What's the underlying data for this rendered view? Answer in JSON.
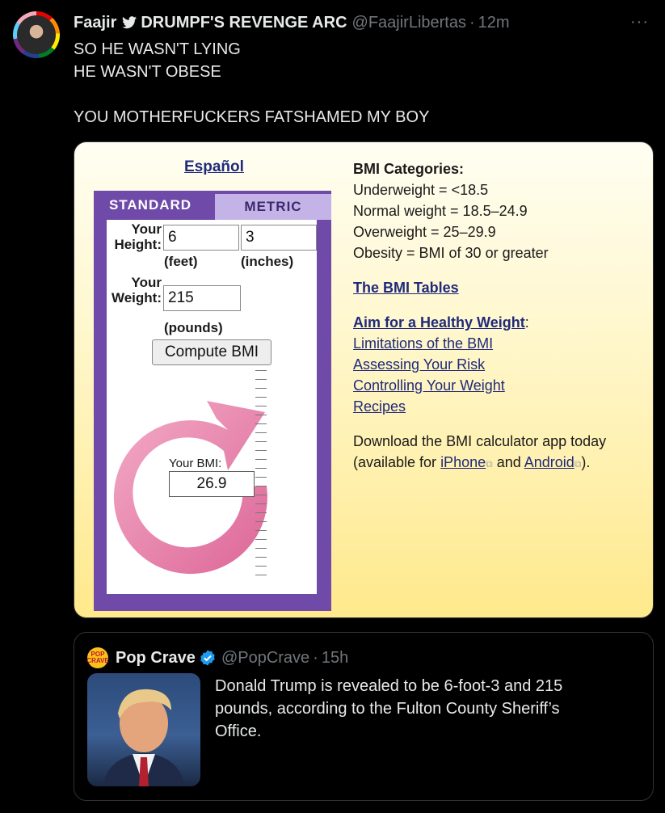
{
  "tweet": {
    "display_name": "Faajir",
    "name_suffix": "DRUMPF'S REVENGE ARC",
    "handle": "@FaajirLibertas",
    "separator": "·",
    "time": "12m",
    "more": "···",
    "lines": [
      "SO HE WASN'T LYING",
      "HE WASN'T OBESE",
      "",
      "YOU MOTHERFUCKERS FATSHAMED MY BOY"
    ]
  },
  "calculator": {
    "espanol": "Español",
    "tab_standard": "STANDARD",
    "tab_metric": "METRIC",
    "height_label_1": "Your",
    "height_label_2": "Height:",
    "feet_value": "6",
    "inches_value": "3",
    "feet_unit": "(feet)",
    "inches_unit": "(inches)",
    "weight_label_1": "Your",
    "weight_label_2": "Weight:",
    "weight_value": "215",
    "pounds_unit": "(pounds)",
    "compute_button": "Compute BMI",
    "your_bmi_label": "Your BMI:",
    "bmi_value": "26.9"
  },
  "bmi_info": {
    "categories_heading": "BMI Categories:",
    "categories": [
      "Underweight = <18.5",
      "Normal weight = 18.5–24.9",
      "Overweight = 25–29.9",
      "Obesity = BMI of 30 or greater"
    ],
    "bmi_tables_link": "The BMI Tables",
    "healthy_weight_link": "Aim for a Healthy Weight",
    "healthy_weight_colon": ":",
    "links": [
      "Limitations of the BMI",
      "Assessing Your Risk",
      "Controlling Your Weight",
      "Recipes"
    ],
    "app_line_1": "Download the BMI calculator app today",
    "app_line_2_prefix": "(available for ",
    "iphone_link": "iPhone",
    "app_and": " and ",
    "android_link": "Android",
    "app_suffix": ")."
  },
  "quote": {
    "avatar_text": "POP CRAVE",
    "name": "Pop Crave",
    "handle": "@PopCrave",
    "separator": "·",
    "time": "15h",
    "text": "Donald Trump is revealed to be 6-foot-3 and 215 pounds, according to the Fulton County Sheriff’s Office."
  },
  "colors": {
    "background": "#000000",
    "text": "#e7e9ea",
    "muted": "#71767b",
    "verified": "#1d9bf0",
    "calc_purple": "#6f4aa8",
    "arrow_pink": "#e0709c",
    "link_navy": "#1f2a7a"
  }
}
